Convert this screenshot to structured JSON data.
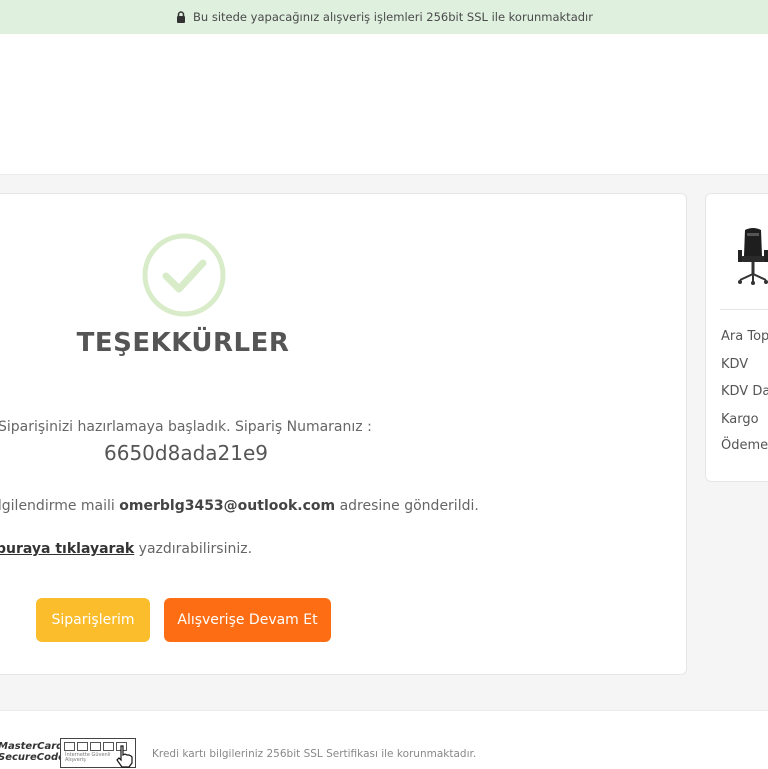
{
  "ssl_bar": {
    "text": "Bu sitede yapacağınız alışveriş işlemleri 256bit SSL ile korunmaktadır",
    "icon": "lock-icon"
  },
  "confirmation": {
    "title": "TEŞEKKÜRLER",
    "order_text": "Siparişinizi hazırlamaya başladık. Sipariş Numaranız :",
    "order_number": "6650d8ada21e9",
    "email_prefix": "ilgilendirme maili",
    "email": "omerblg3453@outlook.com",
    "email_suffix": "adresine gönderildi.",
    "print_link": "buraya tıklayarak",
    "print_suffix": "yazdırabilirsiniz.",
    "check_color": "#d9ecc9"
  },
  "buttons": {
    "orders": "Siparişlerim",
    "continue": "Alışverişe Devam Et",
    "orders_color": "#fbbd2c",
    "continue_color": "#fd6d14"
  },
  "summary": {
    "labels": [
      "Ara Topl",
      "KDV",
      "KDV Dal",
      "Kargo",
      "Ödeme"
    ]
  },
  "footer": {
    "card_logo_line1": "MasterCard.",
    "card_logo_line2": "SecureCode",
    "trust_badge_text": "İnternette Güvenli Alışveriş",
    "text": "Kredi kartı bilgileriniz 256bit SSL Sertifikası ile korunmaktadır."
  }
}
